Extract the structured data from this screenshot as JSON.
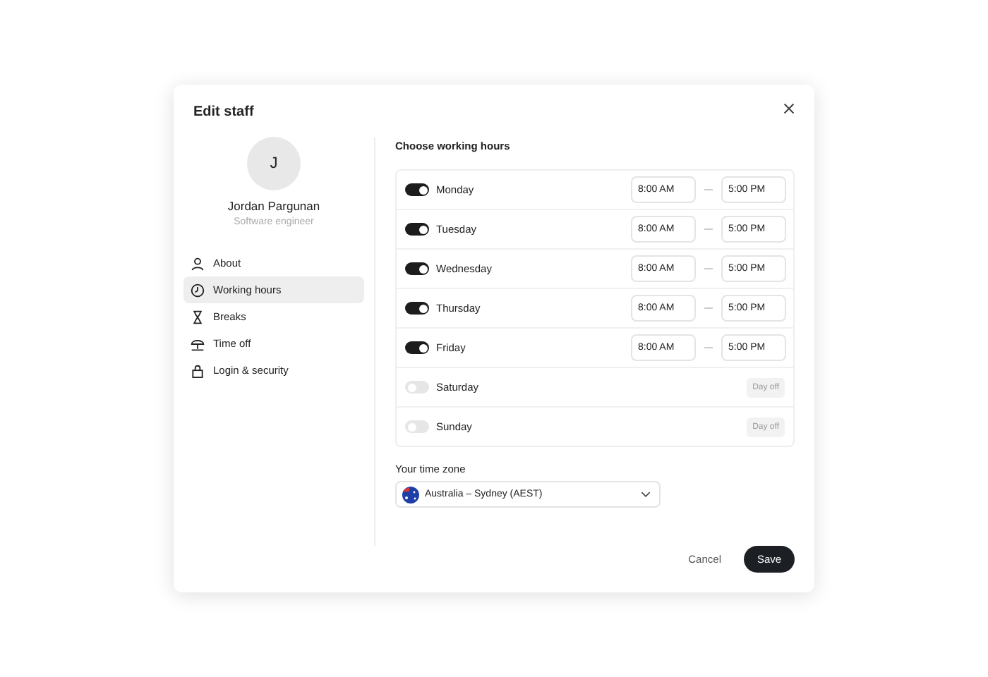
{
  "dialog": {
    "title": "Edit staff"
  },
  "profile": {
    "initial": "J",
    "name": "Jordan Pargunan",
    "role": "Software engineer"
  },
  "nav": [
    {
      "kind": "person",
      "label": "About",
      "selected": false
    },
    {
      "kind": "clock",
      "label": "Working hours",
      "selected": true
    },
    {
      "kind": "hourglass",
      "label": "Breaks",
      "selected": false
    },
    {
      "kind": "umbrella",
      "label": "Time off",
      "selected": false
    },
    {
      "kind": "lock",
      "label": "Login & security",
      "selected": false
    }
  ],
  "section_title": "Choose working hours",
  "days": [
    {
      "name": "Monday",
      "on": true,
      "start": "8:00 AM",
      "end": "5:00 PM"
    },
    {
      "name": "Tuesday",
      "on": true,
      "start": "8:00 AM",
      "end": "5:00 PM"
    },
    {
      "name": "Wednesday",
      "on": true,
      "start": "8:00 AM",
      "end": "5:00 PM"
    },
    {
      "name": "Thursday",
      "on": true,
      "start": "8:00 AM",
      "end": "5:00 PM"
    },
    {
      "name": "Friday",
      "on": true,
      "start": "8:00 AM",
      "end": "5:00 PM"
    },
    {
      "name": "Saturday",
      "on": false,
      "off_label": "Day off"
    },
    {
      "name": "Sunday",
      "on": false,
      "off_label": "Day off"
    }
  ],
  "timezone": {
    "label": "Your time zone",
    "value": "Australia – Sydney (AEST)"
  },
  "buttons": {
    "cancel": "Cancel",
    "save": "Save"
  }
}
